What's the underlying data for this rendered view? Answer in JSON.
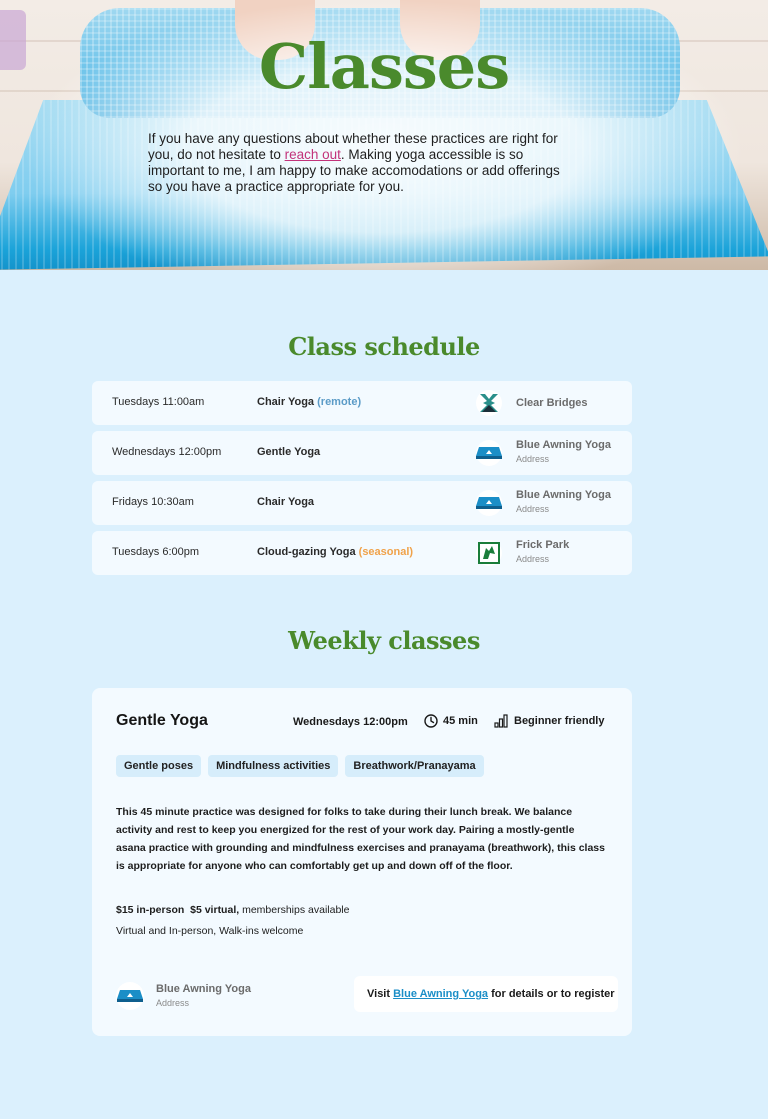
{
  "hero": {
    "title": "Classes",
    "text_before": "If you have any questions about whether these practices are right for you, do not hesitate to ",
    "link": "reach out",
    "text_after": ". Making yoga accessible is so important to me, I am happy to make accomodations or add offerings so you have a practice appropriate for you."
  },
  "schedule": {
    "title": "Class schedule",
    "rows": [
      {
        "time": "Tuesdays 11:00am",
        "class_name": "Chair Yoga",
        "tag": "(remote)",
        "venue": "Clear Bridges",
        "address": "",
        "logo": "clear-bridges-logo"
      },
      {
        "time": "Wednesdays 12:00pm",
        "class_name": "Gentle Yoga",
        "tag": "",
        "venue": "Blue Awning Yoga",
        "address": "Address",
        "logo": "blue-awning-logo"
      },
      {
        "time": "Fridays 10:30am",
        "class_name": "Chair Yoga",
        "tag": "",
        "venue": "Blue Awning Yoga",
        "address": "Address",
        "logo": "blue-awning-logo"
      },
      {
        "time": "Tuesdays 6:00pm",
        "class_name": "Cloud-gazing Yoga",
        "tag": "(seasonal)",
        "venue": "Frick Park",
        "address": "Address",
        "logo": "frick-park-logo"
      }
    ]
  },
  "weekly": {
    "title": "Weekly classes",
    "card": {
      "title": "Gentle Yoga",
      "when": "Wednesdays 12:00pm",
      "duration": "45 min",
      "level": "Beginner friendly",
      "chips": [
        "Gentle poses",
        "Mindfulness activities",
        "Breathwork/Pranayama"
      ],
      "description": "This 45 minute practice was designed for folks to take during their lunch break. We balance activity and rest to keep you energized for the rest of your work day. Pairing a mostly-gentle asana practice with grounding and mindfulness exercises and pranayama (breathwork), this class is appropriate for anyone who can comfortably get up and down off of the floor.",
      "price_in_person": "$15 in-person",
      "price_virtual": "$5 virtual,",
      "price_note": "memberships available",
      "mode": "Virtual and In-person, Walk-ins welcome",
      "venue": "Blue Awning Yoga",
      "address": "Address",
      "visit_prefix": "Visit",
      "visit_link": "Blue Awning Yoga",
      "visit_suffix": "for details or to register"
    }
  },
  "colors": {
    "accent_green": "#4a8a2c",
    "link_pink": "#c2337a",
    "link_blue": "#1b8ec7",
    "remote_blue": "#5b9bc7",
    "seasonal_orange": "#f0a24a",
    "page_bg": "#dbf0fd"
  }
}
